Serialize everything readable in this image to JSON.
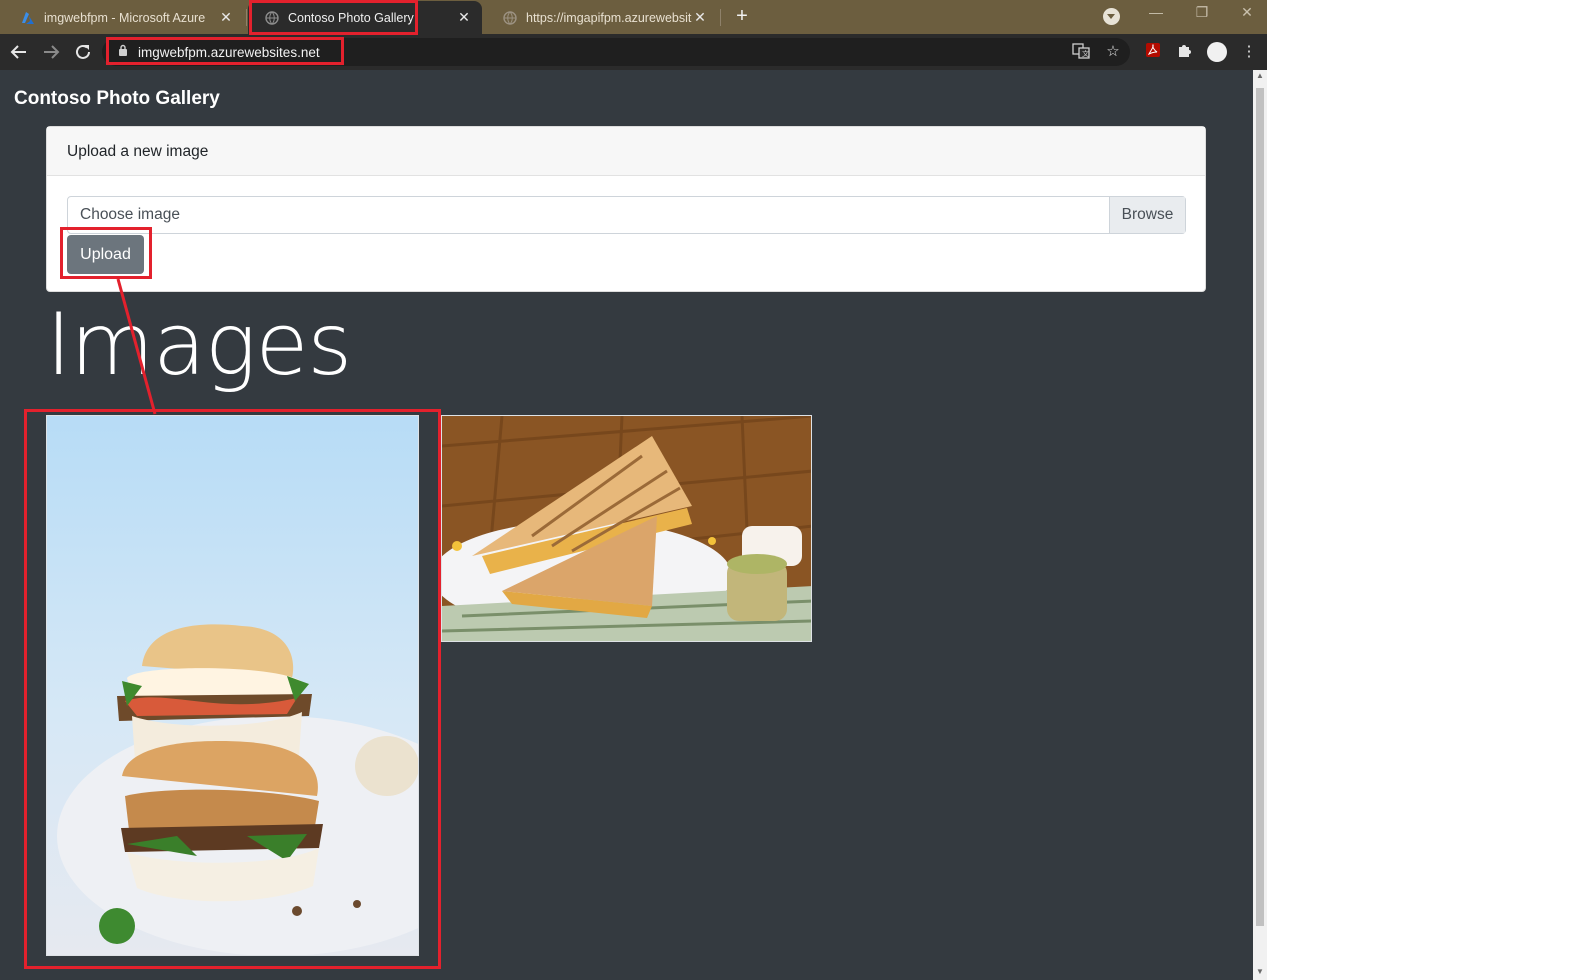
{
  "browser": {
    "tabs": [
      {
        "title": "imgwebfpm - Microsoft Azure",
        "icon": "azure-icon"
      },
      {
        "title": "Contoso Photo Gallery",
        "icon": "globe-icon",
        "active": true
      },
      {
        "title": "https://imgapifpm.azurewebsites",
        "icon": "globe-icon"
      }
    ],
    "new_tab": "+",
    "address": "imgwebfpm.azurewebsites.net"
  },
  "page": {
    "site_title": "Contoso Photo Gallery",
    "upload_card": {
      "header": "Upload a new image",
      "file_placeholder": "Choose image",
      "browse_label": "Browse",
      "upload_label": "Upload"
    },
    "images_heading": "Images",
    "images": [
      {
        "name": "stacked-sandwich-photo"
      },
      {
        "name": "grilled-sandwich-photo"
      }
    ]
  },
  "colors": {
    "page_background": "#343a40",
    "annotation_red": "#e3212d",
    "upload_button": "#6c757d",
    "tab_strip": "#6c5e3f"
  }
}
